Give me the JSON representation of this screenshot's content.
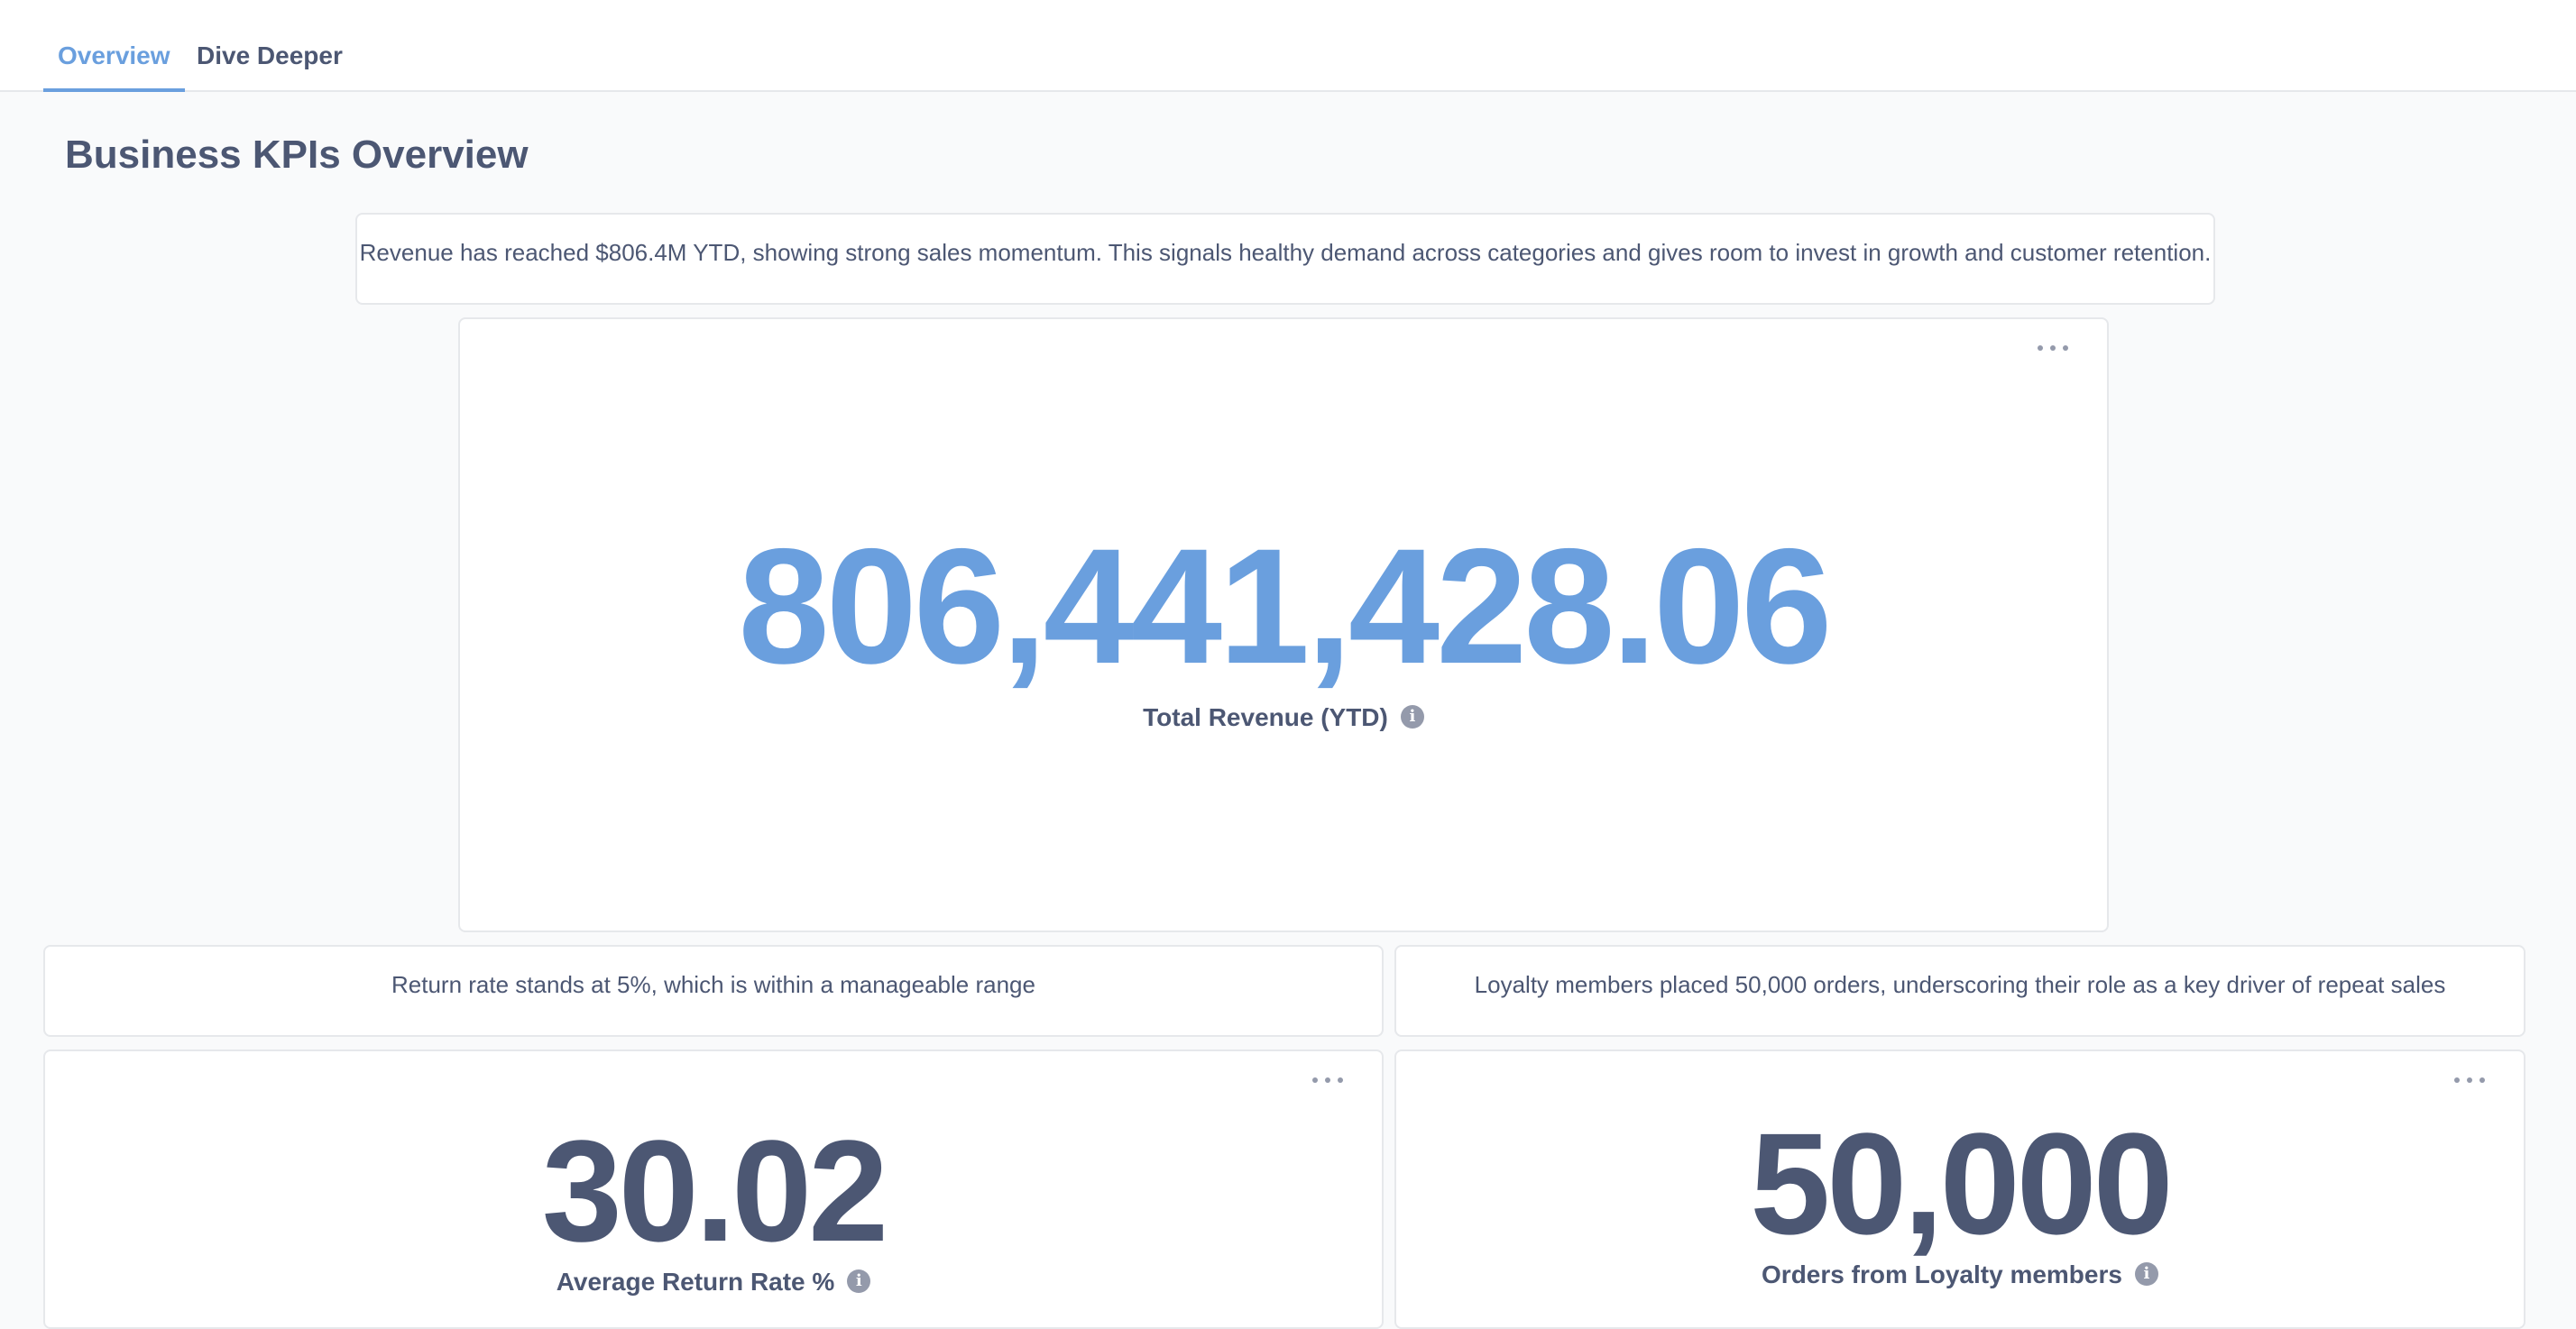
{
  "tabs": [
    {
      "label": "Overview",
      "active": true
    },
    {
      "label": "Dive Deeper",
      "active": false
    }
  ],
  "page": {
    "title": "Business KPIs Overview"
  },
  "revenue": {
    "summary": "Revenue has reached $806.4M YTD, showing strong sales momentum. This signals healthy demand across categories and gives room to invest in growth and customer retention.",
    "value": "806,441,428.06",
    "label": "Total Revenue (YTD)"
  },
  "returns": {
    "summary": "Return rate stands at 5%, which is within a manageable range",
    "value": "30.02",
    "label": "Average Return Rate %"
  },
  "loyalty": {
    "summary": "Loyalty members placed 50,000 orders, underscoring their role as a key driver of repeat sales",
    "value": "50,000",
    "label": "Orders from Loyalty members"
  },
  "icons": {
    "info_glyph": "i",
    "more": "more-horizontal-icon",
    "info": "info-icon"
  },
  "colors": {
    "accent": "#6a9fde",
    "text": "#4c5773",
    "border": "#e6e8eb",
    "background": "#f9fafb"
  }
}
